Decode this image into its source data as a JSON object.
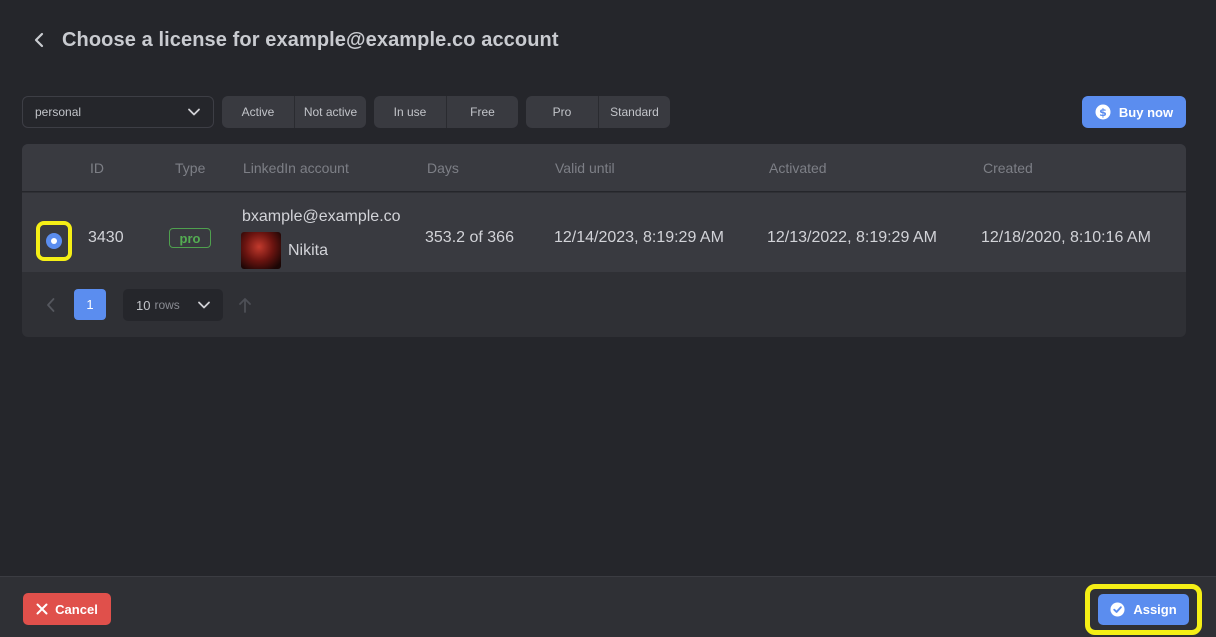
{
  "header": {
    "back_icon": "chevron-left-icon",
    "title": "Choose a license for example@example.co account"
  },
  "filters": {
    "account_select": {
      "value": "personal",
      "icon": "chevron-down-icon"
    },
    "status": [
      "Active",
      "Not active"
    ],
    "usage": [
      "In use",
      "Free"
    ],
    "plan": [
      "Pro",
      "Standard"
    ],
    "buy_button": {
      "label": "Buy now",
      "icon": "dollar-coin-icon"
    }
  },
  "table": {
    "columns": [
      "ID",
      "Type",
      "LinkedIn account",
      "Days",
      "Valid until",
      "Activated",
      "Created"
    ],
    "rows": [
      {
        "selected": true,
        "id": "3430",
        "type": "pro",
        "linkedin_email": "bxample@example.co",
        "linkedin_name": "Nikita",
        "days": "353.2 of 366",
        "valid_until": "12/14/2023, 8:19:29 AM",
        "activated": "12/13/2022, 8:19:29 AM",
        "created": "12/18/2020, 8:10:16 AM"
      }
    ]
  },
  "pagination": {
    "current_page": "1",
    "rows_value": "10",
    "rows_unit": "rows",
    "prev_icon": "chevron-left-icon",
    "sort_icon": "arrow-up-icon"
  },
  "footer": {
    "cancel": {
      "label": "Cancel",
      "icon": "close-icon"
    },
    "assign": {
      "label": "Assign",
      "icon": "check-badge-icon"
    }
  },
  "colors": {
    "background": "#25262b",
    "panel": "#2f3035",
    "accent": "#5b8def",
    "danger": "#e0504b",
    "badge_pro": "#54ad52",
    "highlight": "#f5ef16"
  }
}
